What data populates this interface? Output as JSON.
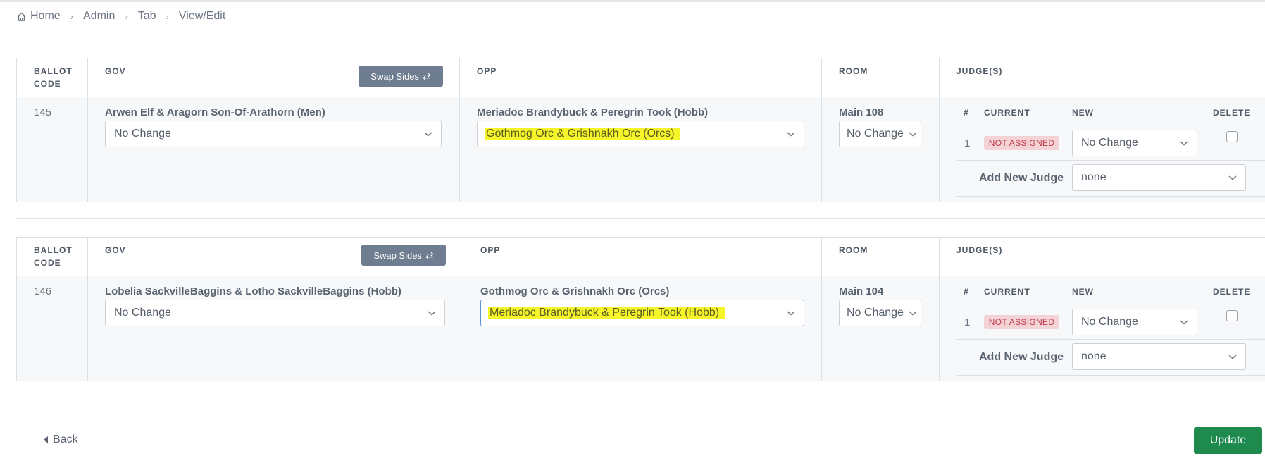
{
  "breadcrumb": [
    "Home",
    "Admin",
    "Tab",
    "View/Edit"
  ],
  "headers": {
    "ballot_code_1": "BALLOT",
    "ballot_code_2": "CODE",
    "gov": "GOV",
    "opp": "OPP",
    "room": "ROOM",
    "judges": "JUDGE(S)",
    "swap_label": "Swap Sides",
    "judge_cols": {
      "num": "#",
      "current": "CURRENT",
      "new": "NEW",
      "delete": "DELETE"
    },
    "add_new_judge": "Add New Judge"
  },
  "ballots": [
    {
      "code": "145",
      "gov_team": "Arwen Elf & Aragorn Son-Of-Arathorn (Men)",
      "gov_select": "No Change",
      "opp_team": "Meriadoc Brandybuck & Peregrin Took (Hobb)",
      "opp_select": "Gothmog Orc & Grishnakh Orc (Orcs)",
      "room": "Main 108",
      "room_select": "No Change",
      "judge_num": "1",
      "judge_current": "NOT ASSIGNED",
      "judge_new": "No Change",
      "add_judge_select": "none"
    },
    {
      "code": "146",
      "gov_team": "Lobelia SackvilleBaggins & Lotho SackvilleBaggins (Hobb)",
      "gov_select": "No Change",
      "opp_team": "Gothmog Orc & Grishnakh Orc (Orcs)",
      "opp_select": "Meriadoc Brandybuck & Peregrin Took (Hobb)",
      "room": "Main 104",
      "room_select": "No Change",
      "judge_num": "1",
      "judge_current": "NOT ASSIGNED",
      "judge_new": "No Change",
      "add_judge_select": "none"
    }
  ],
  "footer": {
    "back_label": "Back",
    "update_label": "Update"
  },
  "colors": {
    "update_green": "#1e8a4e",
    "swap_gray": "#6e7d90",
    "highlight_yellow": "#f5f52a",
    "badge_red": "#c0394a"
  }
}
